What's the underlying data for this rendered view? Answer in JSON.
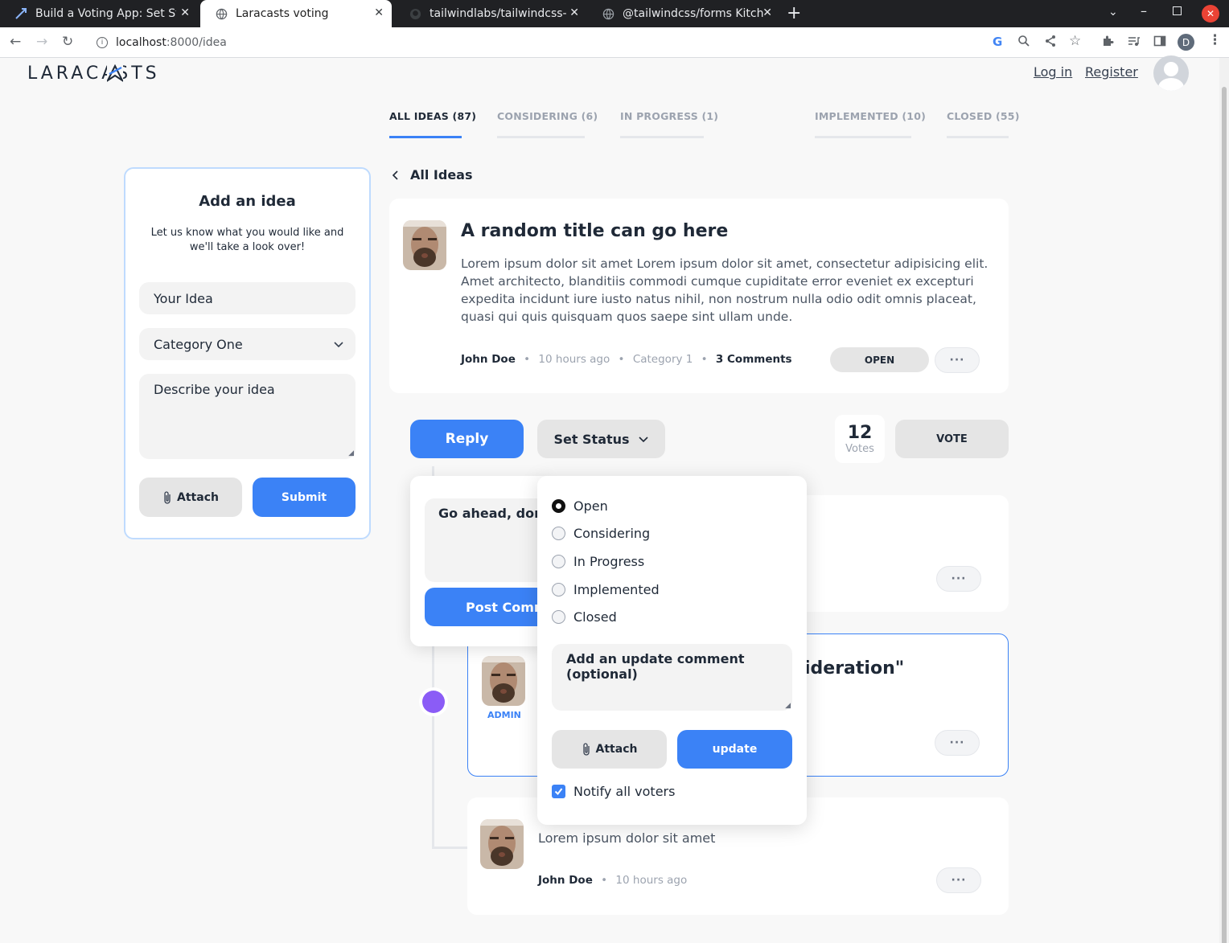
{
  "browser": {
    "tabs": [
      {
        "title": "Build a Voting App: Set St",
        "icon": "arrow-icon"
      },
      {
        "title": "Laracasts voting",
        "icon": "globe-icon"
      },
      {
        "title": "tailwindlabs/tailwindcss-",
        "icon": "github-icon"
      },
      {
        "title": "@tailwindcss/forms Kitch",
        "icon": "globe-icon"
      }
    ],
    "url_host": "localhost",
    "url_path": ":8000/idea",
    "profile_initial": "D"
  },
  "header": {
    "logo": "LARACASTS",
    "login": "Log in",
    "register": "Register"
  },
  "filters": [
    {
      "label": "ALL IDEAS (87)",
      "active": true
    },
    {
      "label": "CONSIDERING (6)",
      "active": false
    },
    {
      "label": "IN PROGRESS (1)",
      "active": false
    },
    {
      "label": "IMPLEMENTED (10)",
      "active": false
    },
    {
      "label": "CLOSED (55)",
      "active": false
    }
  ],
  "add_idea": {
    "title": "Add an idea",
    "subtitle_line1": "Let us know what you would like and",
    "subtitle_line2": "we'll take a look over!",
    "idea_placeholder": "Your Idea",
    "category_selected": "Category One",
    "description_placeholder": "Describe your idea",
    "attach_label": "Attach",
    "submit_label": "Submit"
  },
  "back_link": "All Ideas",
  "idea": {
    "title": "A random title can go here",
    "body": "Lorem ipsum dolor sit amet Lorem ipsum dolor sit amet, consectetur adipisicing elit. Amet architecto, blanditiis commodi cumque cupiditate error eveniet ex excepturi expedita incidunt iure iusto natus nihil, non nostrum nulla odio odit omnis placeat, quasi qui quis quisquam quos saepe sint ullam unde.",
    "author": "John Doe",
    "time": "10 hours ago",
    "category": "Category 1",
    "comments": "3 Comments",
    "status": "OPEN"
  },
  "actions": {
    "reply": "Reply",
    "set_status": "Set Status",
    "votes_count": "12",
    "votes_label": "Votes",
    "vote_button": "VOTE"
  },
  "reply_popup": {
    "placeholder": "Go ahead, don't",
    "post_label": "Post Comme"
  },
  "status_popup": {
    "options": [
      "Open",
      "Considering",
      "In Progress",
      "Implemented",
      "Closed"
    ],
    "selected": "Open",
    "comment_placeholder": "Add an update comment (optional)",
    "attach_label": "Attach",
    "update_label": "update",
    "notify_label": "Notify all voters",
    "notify_checked": true
  },
  "comments": {
    "admin_badge": "ADMIN",
    "admin_title_fragment": "ideration\"",
    "last_body": "Lorem ipsum dolor sit amet",
    "last_author": "John Doe",
    "last_time": "10 hours ago"
  },
  "colors": {
    "accent": "#3b82f6",
    "admin_dot": "#8b5cf6"
  }
}
